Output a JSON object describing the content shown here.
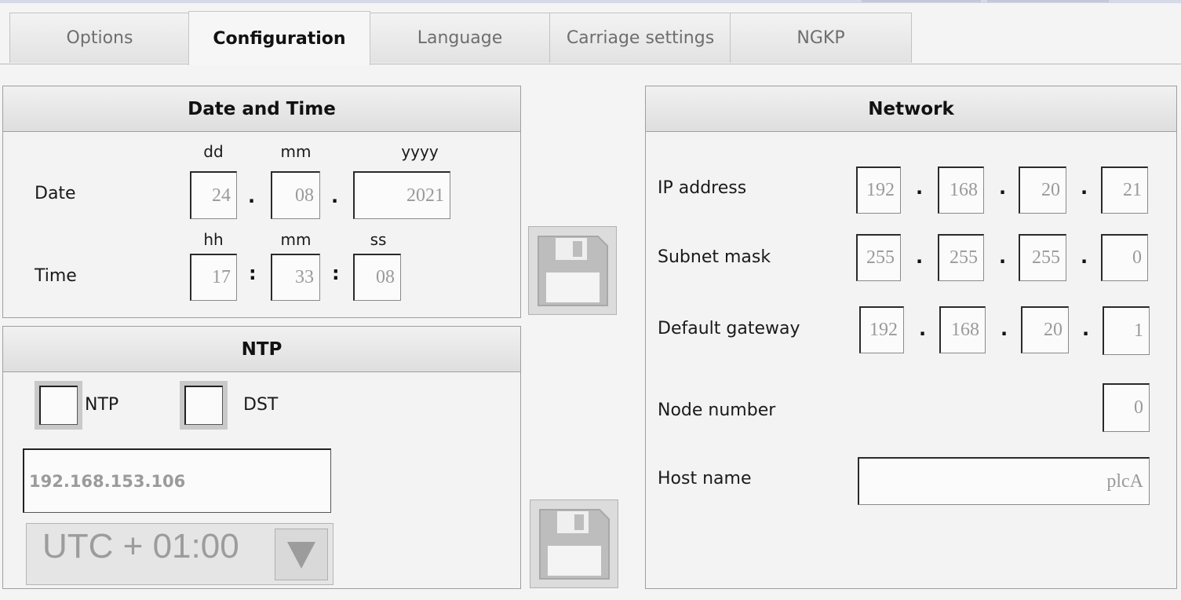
{
  "tabs": [
    "Options",
    "Configuration",
    "Language",
    "Carriage settings",
    "NGKP"
  ],
  "date_time": {
    "title": "Date and Time",
    "date_label": "Date",
    "time_label": "Time",
    "dd_label": "dd",
    "mm_label": "mm",
    "yyyy_label": "yyyy",
    "hh_label": "hh",
    "min_label": "mm",
    "ss_label": "ss",
    "day": "24",
    "month": "08",
    "year": "2021",
    "hour": "17",
    "minute": "33",
    "second": "08",
    "date_sep": ".",
    "time_sep": ":"
  },
  "ntp": {
    "title": "NTP",
    "ntp_label": "NTP",
    "dst_label": "DST",
    "server": "192.168.153.106",
    "timezone": "UTC + 01:00"
  },
  "network": {
    "title": "Network",
    "ip_label": "IP address",
    "subnet_label": "Subnet mask",
    "gateway_label": "Default gateway",
    "node_label": "Node number",
    "host_label": "Host name",
    "ip": [
      "192",
      "168",
      "20",
      "21"
    ],
    "subnet": [
      "255",
      "255",
      "255",
      "0"
    ],
    "gateway": [
      "192",
      "168",
      "20",
      "1"
    ],
    "node": "0",
    "host": "plcA",
    "sep": "."
  },
  "colors": {
    "tab_active_text": "#111111",
    "tab_inactive_text": "#6e6e6e",
    "field_text": "#9a9a9a",
    "panel_border": "#9f9f9f"
  }
}
